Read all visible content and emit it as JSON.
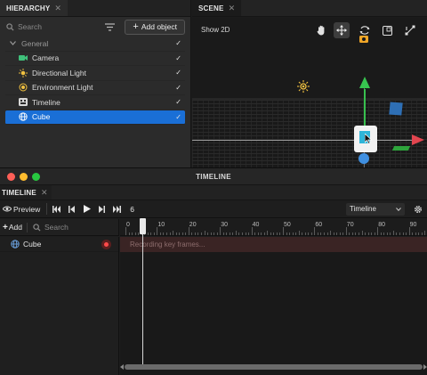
{
  "hierarchy": {
    "tab_label": "HIERARCHY",
    "search_placeholder": "Search",
    "add_object_label": "Add object",
    "group_label": "General",
    "items": [
      {
        "label": "Camera",
        "icon": "camera-icon",
        "checked": true
      },
      {
        "label": "Directional Light",
        "icon": "sun-icon",
        "checked": true
      },
      {
        "label": "Environment Light",
        "icon": "environment-icon",
        "checked": true
      },
      {
        "label": "Timeline",
        "icon": "timeline-icon",
        "checked": true
      },
      {
        "label": "Cube",
        "icon": "globe-icon",
        "checked": true,
        "selected": true
      }
    ]
  },
  "scene": {
    "tab_label": "SCENE",
    "show2d_label": "Show 2D",
    "tools": [
      "hand-icon",
      "move-icon",
      "rotate-icon",
      "scale-icon",
      "transform-icon"
    ]
  },
  "timeline_window": {
    "title": "TIMELINE",
    "tab_label": "TIMELINE",
    "preview_label": "Preview",
    "current_frame": "6",
    "mode_select": "Timeline",
    "add_label": "Add",
    "search_placeholder": "Search",
    "track": {
      "label": "Cube",
      "recording": true
    },
    "recording_text": "Recording key frames...",
    "ruler_labels": [
      "0",
      "10",
      "20",
      "30",
      "40",
      "50",
      "60",
      "70",
      "80",
      "90"
    ]
  },
  "colors": {
    "selection": "#1a6fd6",
    "gizmo_x": "#e2454f",
    "gizmo_y": "#37c54f",
    "gizmo_z": "#3f8fe0",
    "record": "#ff4a4a"
  }
}
